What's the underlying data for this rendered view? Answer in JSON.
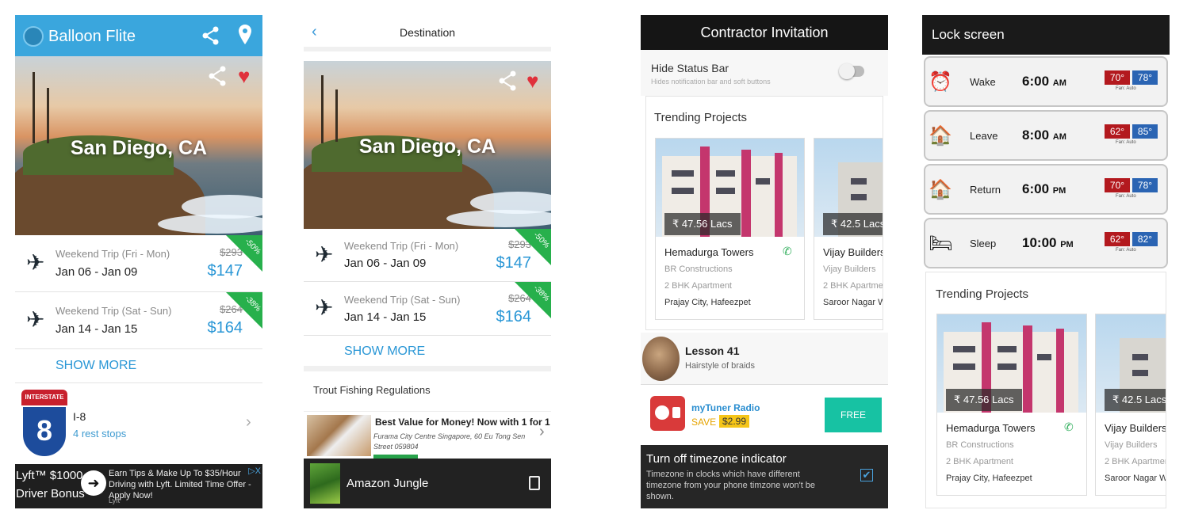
{
  "panel1": {
    "app_title": "Balloon Flite",
    "back_glyph": "〈",
    "hero_title": "San Diego, CA",
    "trips": [
      {
        "label": "Weekend Trip (Fri - Mon)",
        "dates": "Jan 06 - Jan 09",
        "old_price": "$293",
        "new_price": "$147",
        "discount": "-50%"
      },
      {
        "label": "Weekend Trip (Sat - Sun)",
        "dates": "Jan 14 - Jan 15",
        "old_price": "$264",
        "new_price": "$164",
        "discount": "-38%"
      }
    ],
    "show_more": "SHOW MORE",
    "interstate": {
      "banner": "INTERSTATE",
      "number": "8",
      "name": "I-8",
      "stops": "4 rest stops"
    },
    "ad": {
      "line1": "Lyft™ $1000",
      "line2": "Driver Bonus",
      "text": "Earn Tips & Make Up To $35/Hour Driving with Lyft. Limited Time Offer - Apply Now!",
      "sub": "Lyft",
      "close": "▷X"
    }
  },
  "panel2": {
    "back_glyph": "‹",
    "title": "Destination",
    "hero_title": "San Diego, CA",
    "trips": [
      {
        "label": "Weekend Trip (Fri - Mon)",
        "dates": "Jan 06 - Jan 09",
        "old_price": "$293",
        "new_price": "$147",
        "discount": "-50%"
      },
      {
        "label": "Weekend Trip (Sat - Sun)",
        "dates": "Jan 14 - Jan 15",
        "old_price": "$264",
        "new_price": "$164",
        "discount": "-38%"
      }
    ],
    "show_more": "SHOW MORE",
    "section_title": "Trout Fishing Regulations",
    "ad": {
      "title": "Best Value for Money! Now with 1 for 1",
      "sub": "Furama City Centre Singapore, 60 Eu Tong Sen Street 059804"
    },
    "bottom_title": "Amazon Jungle"
  },
  "panel3": {
    "title": "Contractor Invitation",
    "hide_status": {
      "title": "Hide Status Bar",
      "subtitle": "Hides notification bar and soft buttons"
    },
    "trending_title": "Trending Projects",
    "projects": [
      {
        "price": "₹ 47.56 Lacs",
        "name": "Hemadurga Towers",
        "builder": "BR Constructions",
        "type": "2 BHK Apartment",
        "location": "Prajay City, Hafeezpet"
      },
      {
        "price": "₹ 42.5 Lacs",
        "name": "Vijay Builders",
        "builder": "Vijay Builders",
        "type": "2 BHK Apartmen",
        "location": "Saroor Nagar W"
      }
    ],
    "lesson": {
      "title": "Lesson 41",
      "subtitle": "Hairstyle of braids"
    },
    "radio": {
      "title": "myTuner Radio",
      "save": "SAVE",
      "price": "$2.99",
      "button": "FREE"
    },
    "timezone": {
      "title": "Turn off timezone indicator",
      "subtitle": "Timezone in clocks which have different timezone from your phone timzone won't be shown.",
      "checked": true
    }
  },
  "panel4": {
    "title": "Lock screen",
    "schedule": [
      {
        "icon": "alarm-clock-icon",
        "glyph": "⏰",
        "name": "Wake",
        "time": "6:00",
        "ampm": "AM",
        "heat": "70°",
        "cool": "78°",
        "fan": "Fan: Auto"
      },
      {
        "icon": "leave-home-icon",
        "glyph": "🏠",
        "name": "Leave",
        "time": "8:00",
        "ampm": "AM",
        "heat": "62°",
        "cool": "85°",
        "fan": "Fan: Auto"
      },
      {
        "icon": "return-home-icon",
        "glyph": "🏠",
        "name": "Return",
        "time": "6:00",
        "ampm": "PM",
        "heat": "70°",
        "cool": "78°",
        "fan": "Fan: Auto"
      },
      {
        "icon": "sleep-icon",
        "glyph": "🛏",
        "name": "Sleep",
        "time": "10:00",
        "ampm": "PM",
        "heat": "62°",
        "cool": "82°",
        "fan": "Fan: Auto"
      }
    ],
    "trending_title": "Trending Projects",
    "projects": [
      {
        "price": "₹ 47.56 Lacs",
        "name": "Hemadurga Towers",
        "builder": "BR Constructions",
        "type": "2 BHK Apartment",
        "location": "Prajay City, Hafeezpet"
      },
      {
        "price": "₹ 42.5 Lacs",
        "name": "Vijay Builders",
        "builder": "Vijay Builders",
        "type": "2 BHK Apartmen",
        "location": "Saroor Nagar W"
      }
    ]
  },
  "colors": {
    "panel1_bar": "#3aa6dd",
    "price_blue": "#2a97d6",
    "discount_green": "#27b04c",
    "heart_red": "#e0313b",
    "free_teal": "#17c2a3",
    "heat_red": "#b3191e",
    "cool_blue": "#2a64b3"
  }
}
